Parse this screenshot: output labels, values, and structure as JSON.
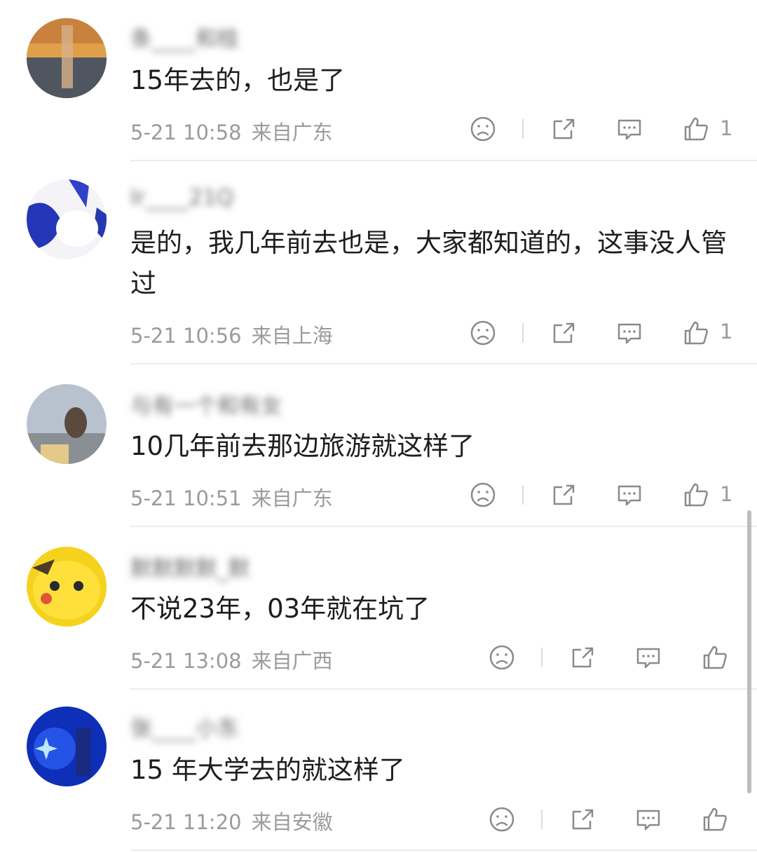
{
  "comments": [
    {
      "username": "条____和桂",
      "text": "15年去的，也是了",
      "date": "5-21 10:58",
      "location": "来自广东",
      "likes": "1"
    },
    {
      "username": "lr____21Q",
      "text": "是的，我几年前去也是，大家都知道的，这事没人管过",
      "date": "5-21 10:56",
      "location": "来自上海",
      "likes": "1"
    },
    {
      "username": "与有一个和有女",
      "text": "10几年前去那边旅游就这样了",
      "date": "5-21 10:51",
      "location": "来自广东",
      "likes": "1"
    },
    {
      "username": "默默默默_默",
      "text": "不说23年，03年就在坑了",
      "date": "5-21 13:08",
      "location": "来自广西",
      "likes": ""
    },
    {
      "username": "张____小东",
      "text": "15 年大学去的就这样了",
      "date": "5-21 11:20",
      "location": "来自安徽",
      "likes": ""
    }
  ],
  "icons": {
    "dislike": "sad-face-icon",
    "share": "share-icon",
    "reply": "comment-bubble-icon",
    "like": "thumbs-up-icon"
  },
  "colors": {
    "icon": "#8a8a8a",
    "meta": "#9b9b9b",
    "divider": "#ececec"
  }
}
